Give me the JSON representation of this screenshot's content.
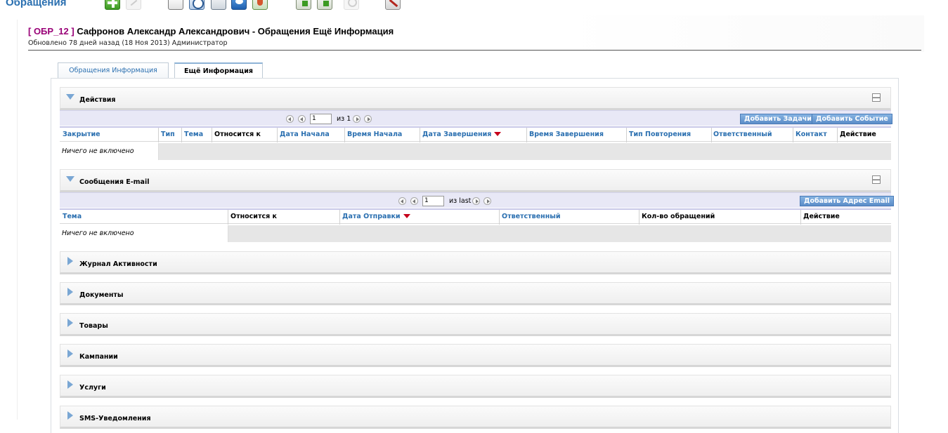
{
  "module": {
    "title": "Обращения"
  },
  "toolbar": {
    "icons": [
      "add-icon",
      "edit-icon",
      "document-icon",
      "clock-icon",
      "calculator-icon",
      "chat-icon",
      "shield-icon",
      "import-icon",
      "export-icon",
      "find-duplicates-icon",
      "tools-icon"
    ]
  },
  "record": {
    "number": "[ ОБР_12 ]",
    "title": " Сафронов Александр Александрович - Обращения Ещё Информация",
    "updated": "Обновлено 78 дней назад (18 Ноя 2013) Администратор"
  },
  "tabs": [
    {
      "label": "Обращения Информация",
      "active": false
    },
    {
      "label": "Ещё Информация",
      "active": true
    }
  ],
  "activities": {
    "title": "Действия",
    "page_value": "1",
    "of_text": "из 1",
    "add_task": "Добавить Задачи",
    "add_event": "Добавить Событие",
    "columns": [
      "Закрытие",
      "Тип",
      "Тема",
      "Относится к",
      "Дата Начала",
      "Время Начала",
      "Дата Завершения",
      "Время Завершения",
      "Тип Повторения",
      "Ответственный",
      "Контакт",
      "Действие"
    ],
    "empty": "Ничего не включено"
  },
  "emails": {
    "title": "Сообщения E-mail",
    "page_value": "1",
    "of_text": "из last",
    "add_email": "Добавить Адрес Email",
    "columns": [
      "Тема",
      "Относится к",
      "Дата Отправки",
      "Ответственный",
      "Кол-во обращений",
      "Действие"
    ],
    "empty": "Ничего не включено"
  },
  "collapsed_blocks": [
    {
      "title": "Журнал Активности"
    },
    {
      "title": "Документы"
    },
    {
      "title": "Товары"
    },
    {
      "title": "Кампании"
    },
    {
      "title": "Услуги"
    },
    {
      "title": "SMS-Уведомления"
    }
  ],
  "colors": {
    "link": "#2a6fb0",
    "record_number": "#990077",
    "button": "#5b8dc8",
    "sort_arrow": "#c6001a"
  }
}
